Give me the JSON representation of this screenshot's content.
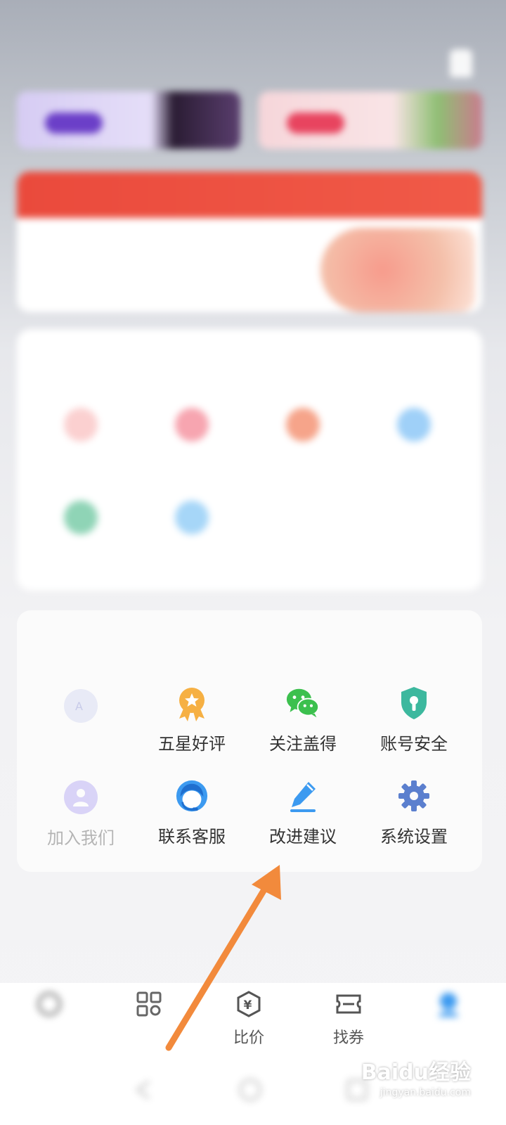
{
  "status_bar": {
    "left": "",
    "right": ""
  },
  "header": {
    "user_line": "",
    "user_icon": "user-icon"
  },
  "common_tools": {
    "title": "",
    "items": [
      {
        "label": "",
        "icon": "gift-icon",
        "color": "#f05a5a"
      },
      {
        "label": "",
        "icon": "heart-icon",
        "color": "#f06a7a"
      },
      {
        "label": "",
        "icon": "bag-icon",
        "color": "#f08060"
      },
      {
        "label": "",
        "icon": "star-icon",
        "color": "#5aaaf0"
      },
      {
        "label": "",
        "icon": "tree-icon",
        "color": "#40b080"
      },
      {
        "label": "",
        "icon": "chat-icon",
        "color": "#5ab0f0"
      }
    ]
  },
  "service_tools": {
    "title": "",
    "items": [
      {
        "label": "",
        "icon": "font-size-icon",
        "color": "#8e98d8"
      },
      {
        "label": "五星好评",
        "icon": "medal-star-icon",
        "color": "#f6b043"
      },
      {
        "label": "关注盖得",
        "icon": "wechat-icon",
        "color": "#3cc04e"
      },
      {
        "label": "账号安全",
        "icon": "shield-lock-icon",
        "color": "#3cb89e"
      },
      {
        "label": "加入我们",
        "icon": "person-icon",
        "color": "#9b8cf0"
      },
      {
        "label": "联系客服",
        "icon": "headset-icon",
        "color": "#3c9af0"
      },
      {
        "label": "改进建议",
        "icon": "pencil-icon",
        "color": "#3c9af0"
      },
      {
        "label": "系统设置",
        "icon": "gear-icon",
        "color": "#5b7fce"
      }
    ]
  },
  "bottom_nav": [
    {
      "label": "",
      "icon": "home-icon"
    },
    {
      "label": "",
      "icon": "grid-icon"
    },
    {
      "label": "比价",
      "icon": "yuan-icon"
    },
    {
      "label": "找券",
      "icon": "coupon-icon"
    },
    {
      "label": "",
      "icon": "profile-icon",
      "active_color": "#3c9af0"
    }
  ],
  "watermark": {
    "brand": "Baidu经验",
    "url": "jingyan.baidu.com"
  },
  "annotation": {
    "arrow_color": "#f28a3c"
  }
}
